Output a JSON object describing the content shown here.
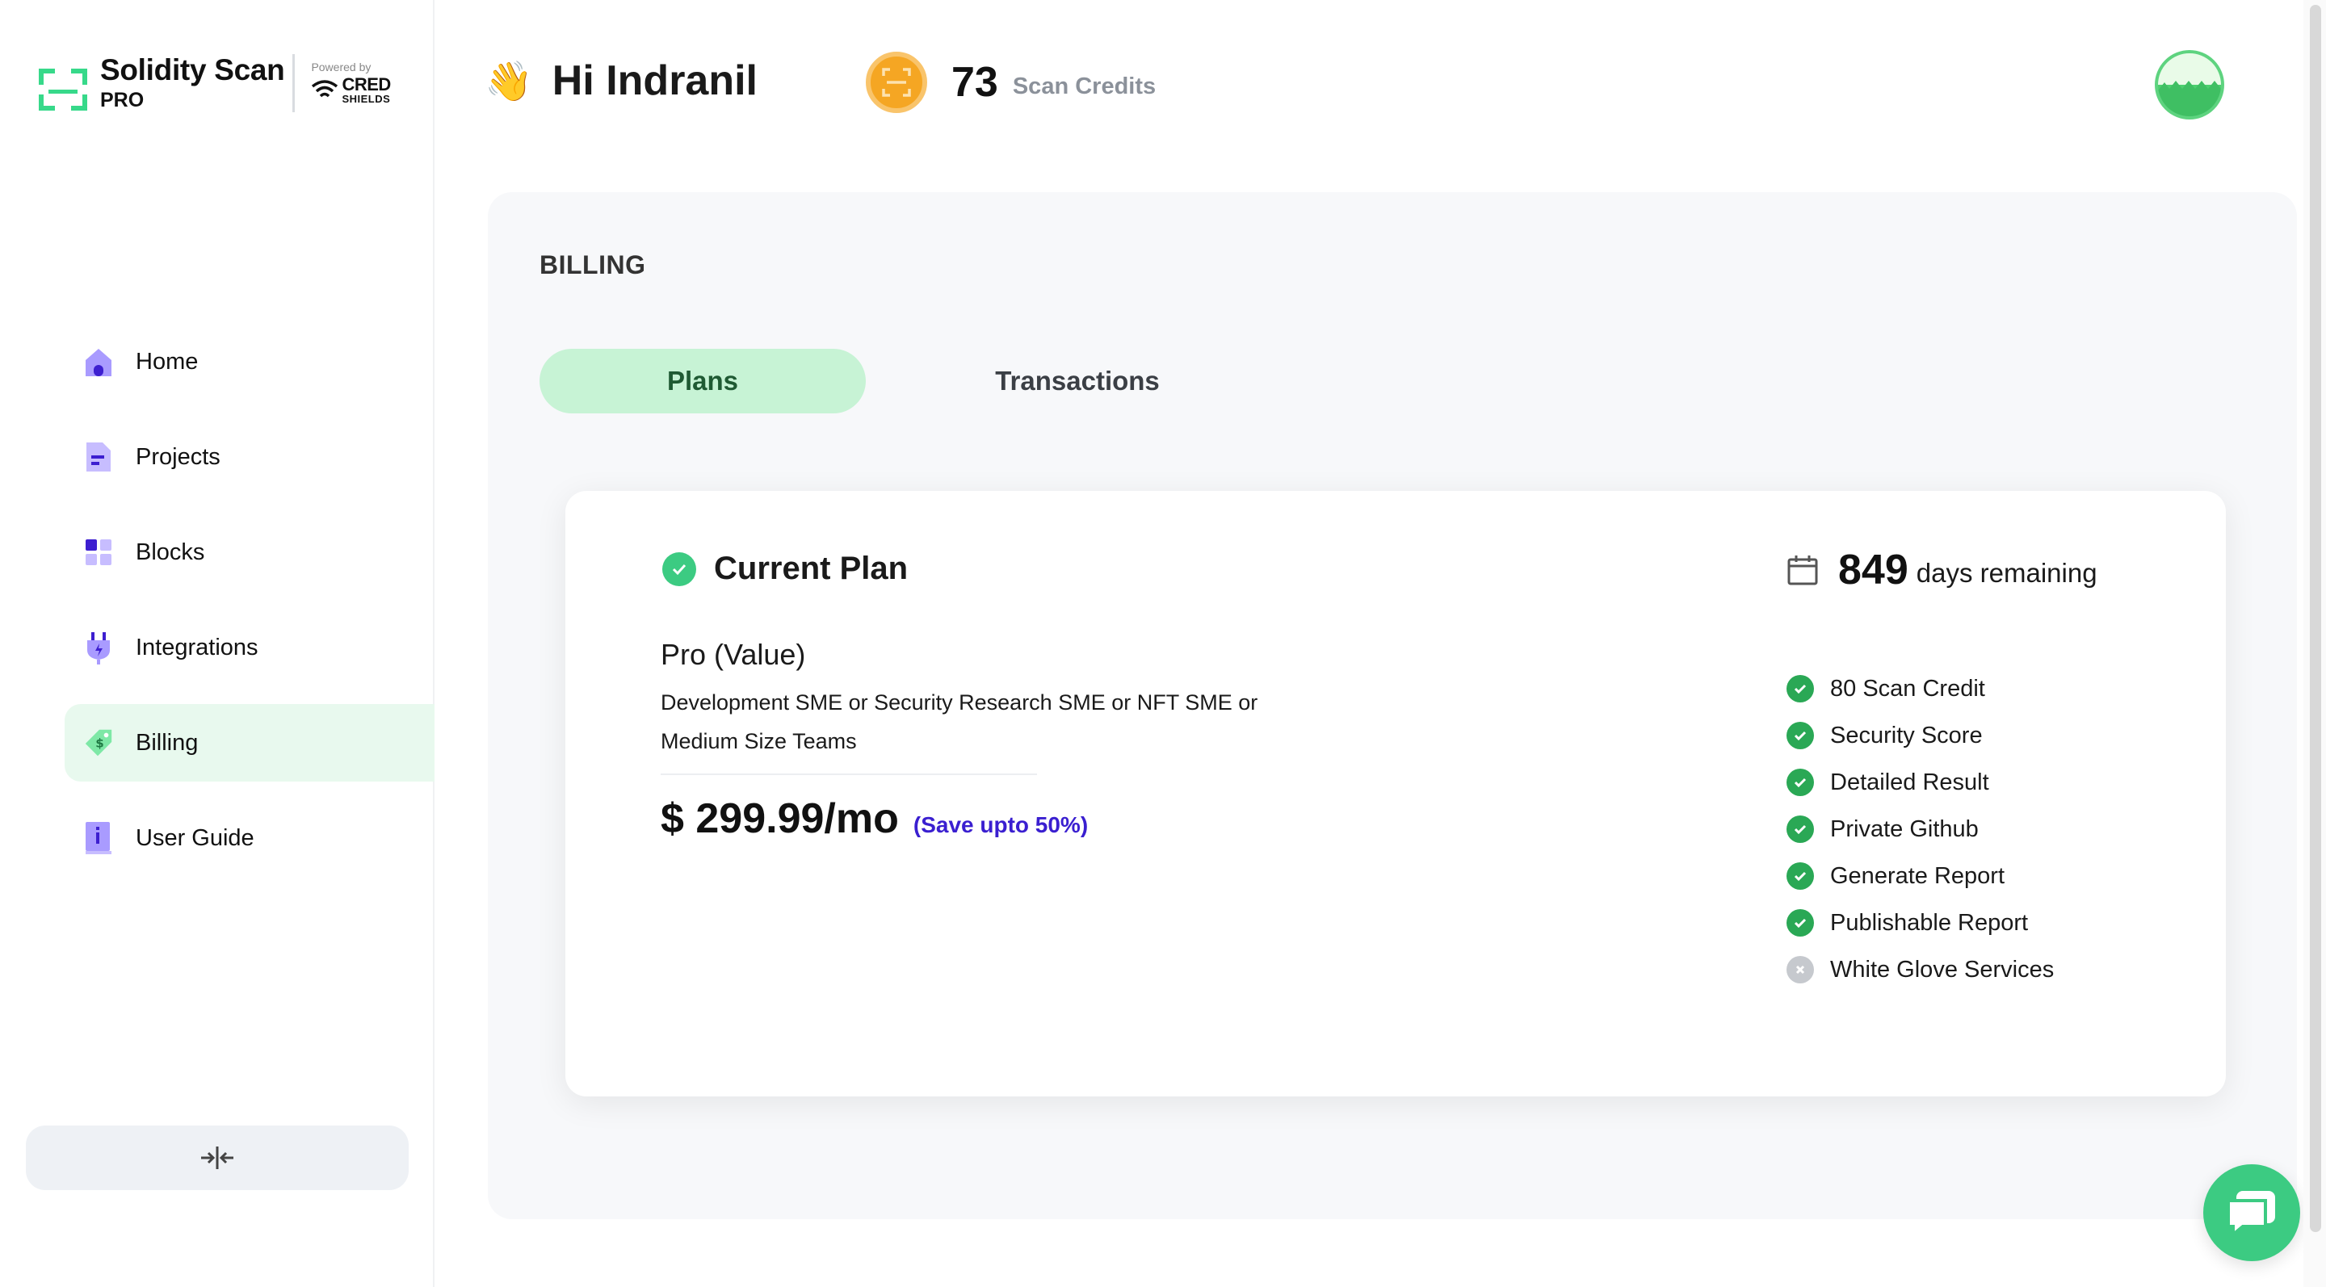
{
  "brand": {
    "name": "Solidity Scan",
    "tier": "PRO",
    "powered_label": "Powered by",
    "partner_name": "CRED",
    "partner_sub": "SHIELDS"
  },
  "header": {
    "greeting": "Hi Indranil",
    "wave_emoji": "👋",
    "credits_value": "73",
    "credits_label": "Scan Credits"
  },
  "sidebar": {
    "items": [
      {
        "label": "Home",
        "icon": "home-icon"
      },
      {
        "label": "Projects",
        "icon": "document-icon"
      },
      {
        "label": "Blocks",
        "icon": "blocks-icon"
      },
      {
        "label": "Integrations",
        "icon": "plug-icon"
      },
      {
        "label": "Billing",
        "icon": "money-tag-icon",
        "active": true
      },
      {
        "label": "User Guide",
        "icon": "info-book-icon"
      }
    ]
  },
  "billing": {
    "title": "BILLING",
    "tabs": [
      {
        "label": "Plans",
        "active": true
      },
      {
        "label": "Transactions",
        "active": false
      }
    ],
    "current_plan": {
      "heading": "Current Plan",
      "plan_name": "Pro (Value)",
      "description": "Development SME or Security Research SME or NFT SME or Medium Size Teams",
      "price": "$ 299.99/mo",
      "save_text": "(Save upto 50%)",
      "days_value": "849",
      "days_label": "days remaining",
      "features": [
        {
          "label": "80 Scan Credit",
          "included": true
        },
        {
          "label": "Security Score",
          "included": true
        },
        {
          "label": "Detailed Result",
          "included": true
        },
        {
          "label": "Private Github",
          "included": true
        },
        {
          "label": "Generate Report",
          "included": true
        },
        {
          "label": "Publishable Report",
          "included": true
        },
        {
          "label": "White Glove Services",
          "included": false
        }
      ]
    }
  },
  "colors": {
    "accent_green": "#3ccb82",
    "tab_active_bg": "#c7f3d5",
    "save_text": "#3a1fd0",
    "coin": "#f5a623",
    "nav_icon_purple": "#7b61ff"
  }
}
